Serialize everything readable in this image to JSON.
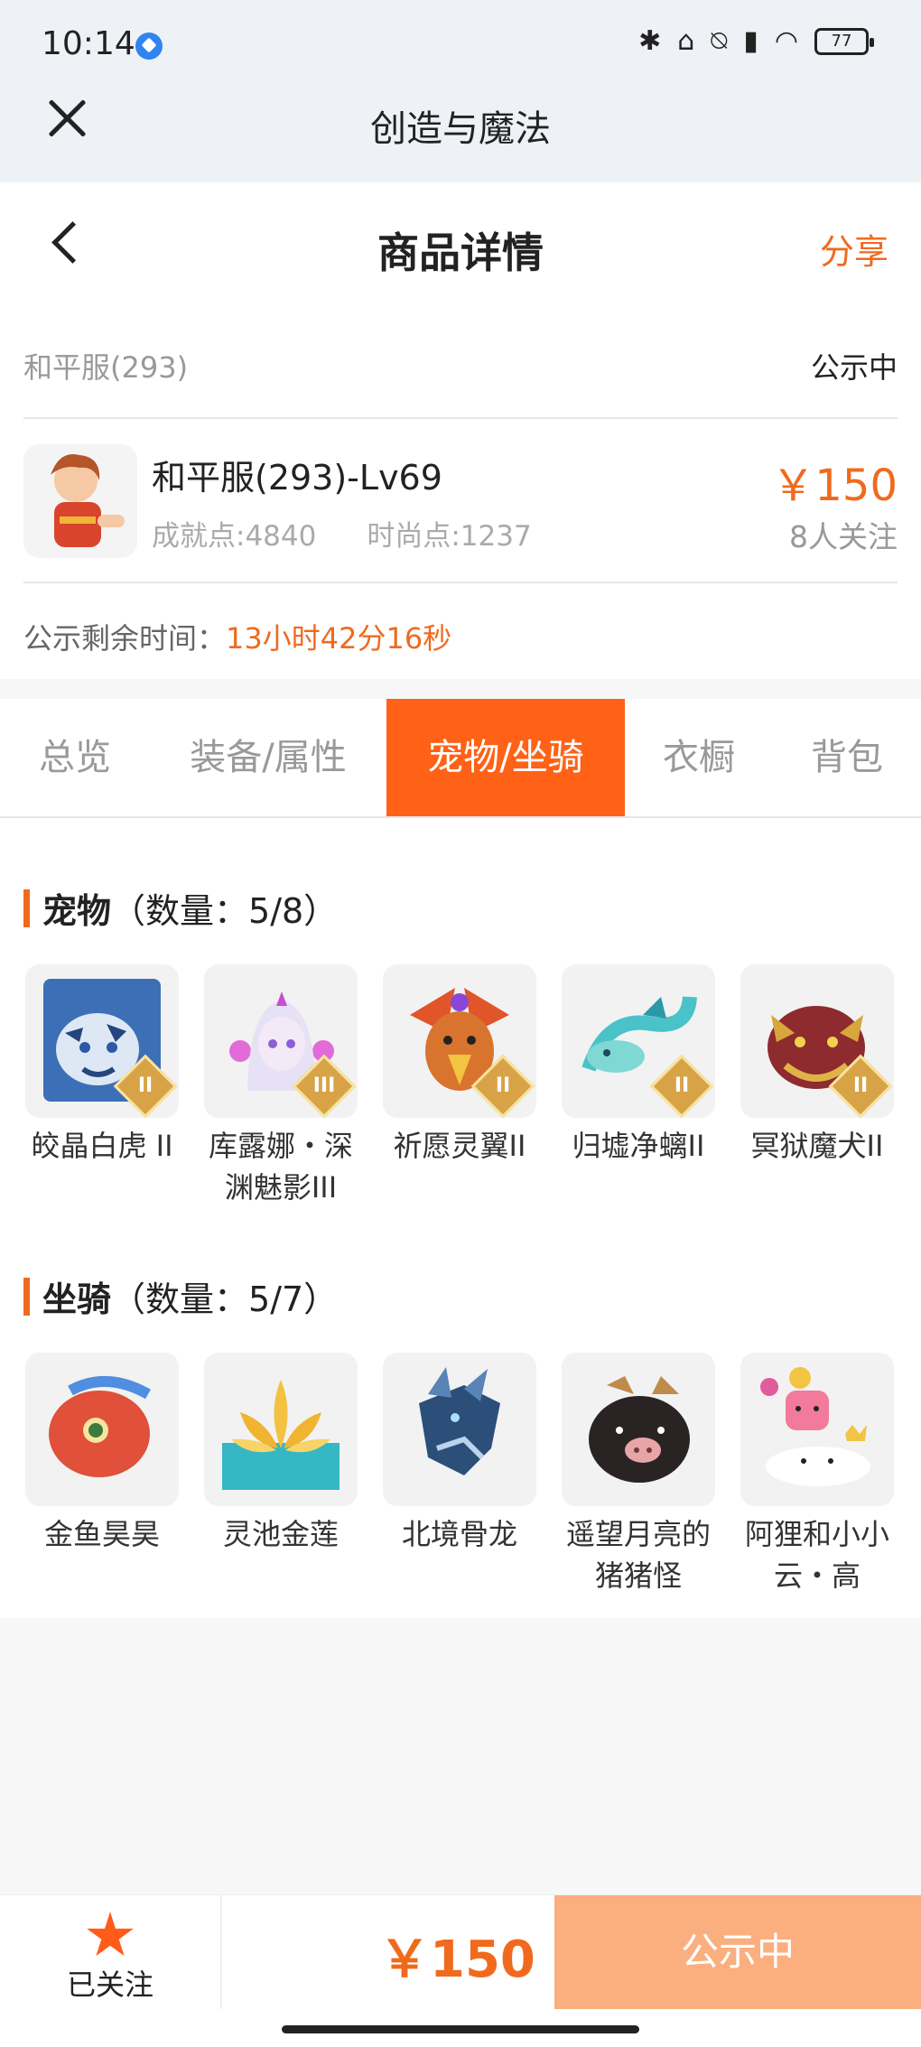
{
  "status": {
    "time": "10:14",
    "battery": "77"
  },
  "app": {
    "title": "创造与魔法"
  },
  "header": {
    "title": "商品详情",
    "share": "分享"
  },
  "item": {
    "server": "和平服(293)",
    "state": "公示中",
    "name": "和平服(293)-Lv69",
    "achievement": "成就点:4840",
    "fashion": "时尚点:1237",
    "price": "￥150",
    "followers": "8人关注",
    "remain_label": "公示剩余时间：",
    "remain_time": "13小时42分16秒"
  },
  "tabs": [
    {
      "label": "总览"
    },
    {
      "label": "装备/属性"
    },
    {
      "label": "宠物/坐骑"
    },
    {
      "label": "衣橱"
    },
    {
      "label": "背包"
    }
  ],
  "pets": {
    "title": "宠物",
    "count": "（数量：5/8）",
    "items": [
      {
        "name": "皎晶白虎 II",
        "badge": "II"
      },
      {
        "name": "库露娜・深渊魅影III",
        "badge": "III"
      },
      {
        "name": "祈愿灵翼II",
        "badge": "II"
      },
      {
        "name": "归墟净螭II",
        "badge": "II"
      },
      {
        "name": "冥狱魔犬II",
        "badge": "II"
      }
    ]
  },
  "mounts": {
    "title": "坐骑",
    "count": "（数量：5/7）",
    "items": [
      {
        "name": "金鱼昊昊"
      },
      {
        "name": "灵池金莲"
      },
      {
        "name": "北境骨龙"
      },
      {
        "name": "遥望月亮的猪猪怪"
      },
      {
        "name": "阿狸和小小云・高"
      }
    ]
  },
  "bottom": {
    "follow": "已关注",
    "price": "￥150",
    "button": "公示中"
  }
}
